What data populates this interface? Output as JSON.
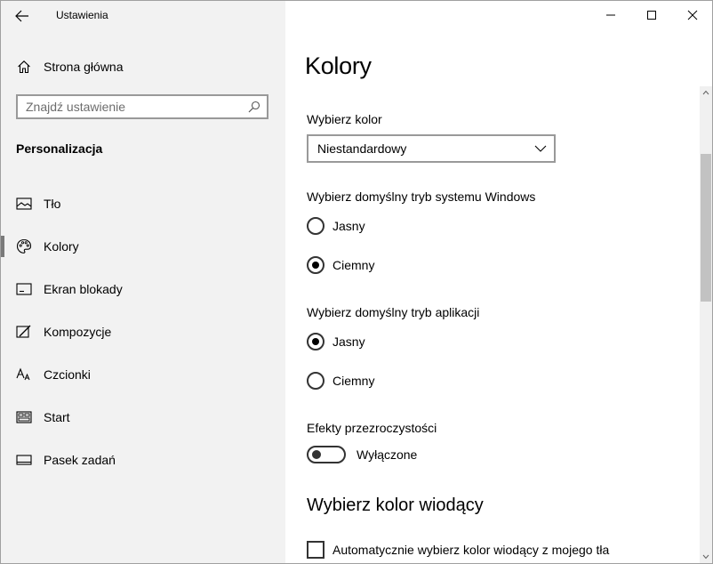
{
  "window": {
    "title": "Ustawienia"
  },
  "sidebar": {
    "home_label": "Strona główna",
    "search_placeholder": "Znajdź ustawienie",
    "section_title": "Personalizacja",
    "items": [
      {
        "label": "Tło",
        "icon": "image-icon",
        "selected": false
      },
      {
        "label": "Kolory",
        "icon": "palette-icon",
        "selected": true
      },
      {
        "label": "Ekran blokady",
        "icon": "lock-screen-icon",
        "selected": false
      },
      {
        "label": "Kompozycje",
        "icon": "brush-icon",
        "selected": false
      },
      {
        "label": "Czcionki",
        "icon": "font-icon",
        "selected": false
      },
      {
        "label": "Start",
        "icon": "start-menu-icon",
        "selected": false
      },
      {
        "label": "Pasek zadań",
        "icon": "taskbar-icon",
        "selected": false
      }
    ]
  },
  "main": {
    "title": "Kolory",
    "choose_color": {
      "label": "Wybierz kolor",
      "value": "Niestandardowy"
    },
    "windows_mode": {
      "label": "Wybierz domyślny tryb systemu Windows",
      "options": [
        {
          "label": "Jasny",
          "checked": false
        },
        {
          "label": "Ciemny",
          "checked": true
        }
      ]
    },
    "app_mode": {
      "label": "Wybierz domyślny tryb aplikacji",
      "options": [
        {
          "label": "Jasny",
          "checked": true
        },
        {
          "label": "Ciemny",
          "checked": false
        }
      ]
    },
    "transparency": {
      "label": "Efekty przezroczystości",
      "state": "Wyłączone",
      "on": false
    },
    "accent_heading": "Wybierz kolor wiodący",
    "accent_auto": {
      "label": "Automatycznie wybierz kolor wiodący z mojego tła",
      "checked": false
    }
  },
  "colors": {
    "sidebar_bg": "#f2f2f2",
    "selection_bar": "#7a7a7a",
    "control_border": "#333333"
  }
}
